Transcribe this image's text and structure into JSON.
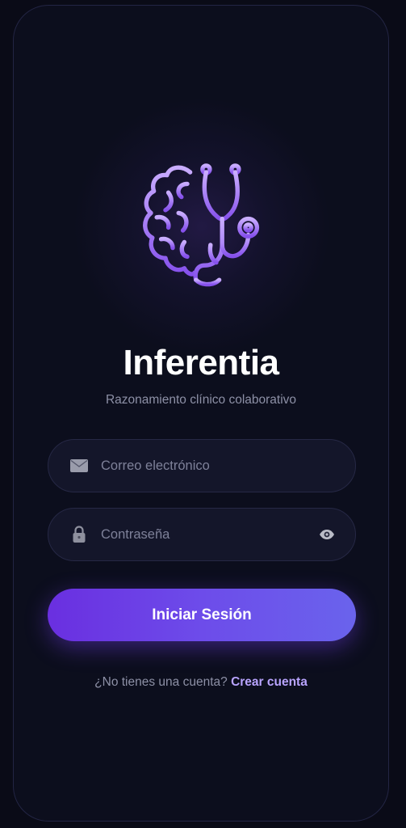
{
  "app": {
    "title": "Inferentia",
    "subtitle": "Razonamiento clínico colaborativo"
  },
  "logo": {
    "icon": "brain-stethoscope-icon",
    "colors": [
      "#c5a6ff",
      "#8a5cf0"
    ]
  },
  "form": {
    "email": {
      "icon": "envelope-icon",
      "placeholder": "Correo electrónico",
      "value": ""
    },
    "password": {
      "icon": "lock-icon",
      "placeholder": "Contraseña",
      "value": "",
      "toggle_icon": "eye-icon"
    },
    "submit_label": "Iniciar Sesión"
  },
  "footer": {
    "prompt": "¿No tienes una cuenta?",
    "link_label": "Crear cuenta"
  },
  "colors": {
    "background": "#0c0e1d",
    "accent": "#6d4cea",
    "link": "#b9a4ff"
  }
}
